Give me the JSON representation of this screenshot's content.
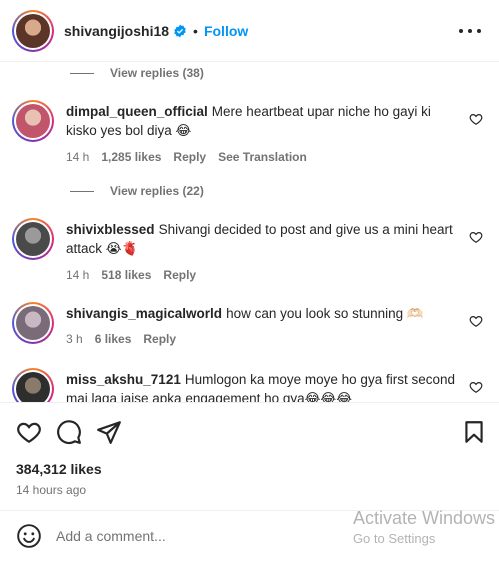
{
  "header": {
    "username": "shivangijoshi18",
    "separator": "•",
    "follow_label": "Follow"
  },
  "comments": {
    "view_replies_1": "View replies (38)",
    "view_replies_2": "View replies (22)",
    "items": [
      {
        "username": "dimpal_queen_official",
        "text": "Mere heartbeat upar niche ho gayi ki kisko yes bol diya 😂",
        "time": "14 h",
        "likes": "1,285 likes",
        "reply": "Reply",
        "translation": "See Translation",
        "avatar_color": "#c8a090"
      },
      {
        "username": "shivixblessed",
        "text": "Shivangi decided to post and give us a mini heart attack 😭🫀",
        "time": "14 h",
        "likes": "518 likes",
        "reply": "Reply",
        "avatar_color": "#6b6b6b"
      },
      {
        "username": "shivangis_magicalworld",
        "text": "how can you look so stunning 🫶🏻",
        "time": "3 h",
        "likes": "6 likes",
        "reply": "Reply",
        "avatar_color": "#8e7f8a"
      },
      {
        "username": "miss_akshu_7121",
        "text": "Humlogon ka moye moye ho gya first second mai laga jaise apka engagement ho gya😂😂😂",
        "avatar_color": "#3a3a3a"
      }
    ]
  },
  "actions": {
    "likes": "384,312 likes",
    "time_ago": "14 hours ago"
  },
  "add_comment": {
    "placeholder": "Add a comment..."
  },
  "watermark": {
    "line1": "Activate Windows",
    "line2": "Go to Settings"
  },
  "colors": {
    "accent": "#0095f6",
    "text": "#262626",
    "muted": "#737373",
    "border": "#efefef"
  },
  "icons": {
    "verified": "verified-badge-icon",
    "more": "more-options-icon",
    "heart": "heart-icon",
    "comment": "comment-icon",
    "share": "share-icon",
    "bookmark": "bookmark-icon",
    "emoji": "emoji-icon"
  }
}
